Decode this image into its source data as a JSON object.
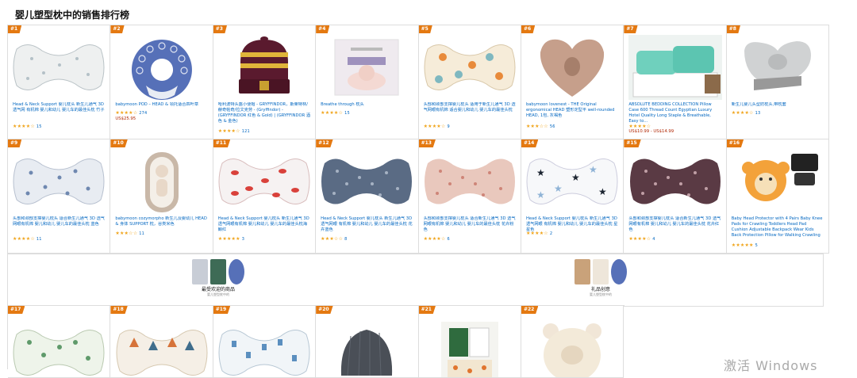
{
  "page": {
    "title": "婴儿塑型枕中的销售排行榜",
    "watermark": "激活 Windows"
  },
  "row1": [
    {
      "rank": "#1",
      "title": "Head & Neck Support 婴儿枕头 新生儿通气 3D 透气网 有机棉 婴儿和幼儿 婴儿车的最佳头枕 竹子",
      "stars": "★★★★☆",
      "count": "15",
      "price": ""
    },
    {
      "rank": "#2",
      "title": "babymoon POD – HEAD & 领托适合四叶草",
      "stars": "★★★★☆",
      "count": "274",
      "price": "US$25.95"
    },
    {
      "rank": "#3",
      "title": "哈利波特头盔小便帽 - GRYFFINDOR，斯莱特林/赫奇帕奇/拉文克劳 - (Gryffindor) - (GRYFFINDOR 红色 & Gold) | (GRYFFINDOR 酒色 & 金色)",
      "stars": "★★★★☆",
      "count": "121",
      "price": ""
    },
    {
      "rank": "#4",
      "title": "Breathe through 枕头",
      "stars": "★★★★☆",
      "count": "15",
      "price": ""
    },
    {
      "rank": "#5",
      "title": "头部和颈部支撑婴儿枕头 适用于新生儿通气 3D 透气网眼有机棉 适合婴儿和幼儿 婴儿车的最佳头枕",
      "stars": "★★★★☆",
      "count": "9",
      "price": ""
    },
    {
      "rank": "#6",
      "title": "babymoon lovenest - THE Original ergonomical HEAD 塑形定型平 well-rounded HEAD, 1包, 灰褐色",
      "stars": "★★★☆☆",
      "count": "56",
      "price": ""
    },
    {
      "rank": "#7",
      "title": "ABSOLUTE BEDDING COLLECTION Pillow Case 600 Thread Count Egyptian Luxury Hotel Quality Long Staple & Breathable, Easy to...",
      "stars": "★★★★☆",
      "count": "",
      "price": "US$10.99 - US$14.99"
    },
    {
      "rank": "#8",
      "title": "新生儿婴儿头型防枕头,带枕套",
      "stars": "★★★★☆",
      "count": "13",
      "price": ""
    }
  ],
  "row2": [
    {
      "rank": "#9",
      "title": "头部和颈部支撑婴儿枕头 适合新生儿通气 3D 透气网眼有机棉 婴儿和幼儿 婴儿车的最佳头枕 蓝色",
      "stars": "★★★★☆",
      "count": "11",
      "price": ""
    },
    {
      "rank": "#10",
      "title": "babymoon cozymorpho 新生儿及婴幼儿 HEAD & 身体 SUPPORT 枕，谷类米色",
      "stars": "★★★☆☆",
      "count": "11",
      "price": ""
    },
    {
      "rank": "#11",
      "title": "Head & Neck Support 婴儿枕头 新生儿通气 3D 透气网眼有机棉 婴儿和幼儿 婴儿车的最佳头枕海鲸红",
      "stars": "★★★★★",
      "count": "3",
      "price": ""
    },
    {
      "rank": "#12",
      "title": "Head & Neck Support 婴儿枕头 新生儿通气 3D 透气网眼 有机棉 婴儿和幼儿 婴儿车的最佳头枕 花卉蓝色",
      "stars": "★★★☆☆",
      "count": "8",
      "price": ""
    },
    {
      "rank": "#13",
      "title": "头部和颈部支撑婴儿枕头 适合新生儿通气 3D 透气网眼有机棉 婴儿和幼儿 婴儿车的最佳头枕 花卉粉色",
      "stars": "★★★★☆",
      "count": "6",
      "price": ""
    },
    {
      "rank": "#14",
      "title": "Head & Neck Support 婴儿枕头 新生儿通气 3D 透气网眼 有机棉 婴儿和幼儿 婴儿车的最佳头枕 星星色",
      "stars": "★★★★☆",
      "count": "2",
      "price": ""
    },
    {
      "rank": "#15",
      "title": "头部和颈部支撑婴儿枕头 适合新生儿通气 3D 透气网眼有机棉 婴儿和幼儿 婴儿车的最佳头枕 花卉红色",
      "stars": "★★★★☆",
      "count": "4",
      "price": ""
    },
    {
      "rank": "#16",
      "title": "Baby Head Protector with 4 Pairs Baby Knee Pads for Crawling Toddlers Head Pad Cushion Adjustable Backpack Wear Kids Back Protection Pillow for Walking Crawling",
      "stars": "★★★★★",
      "count": "5",
      "price": ""
    }
  ],
  "ads": [
    {
      "label": "最受欢迎的商品",
      "sub": "婴儿塑型枕中的"
    },
    {
      "label": "礼品创意",
      "sub": "婴儿塑型枕中的"
    }
  ],
  "row3": [
    {
      "rank": "#17"
    },
    {
      "rank": "#18"
    },
    {
      "rank": "#19"
    },
    {
      "rank": "#20"
    },
    {
      "rank": "#21"
    },
    {
      "rank": "#22"
    }
  ]
}
